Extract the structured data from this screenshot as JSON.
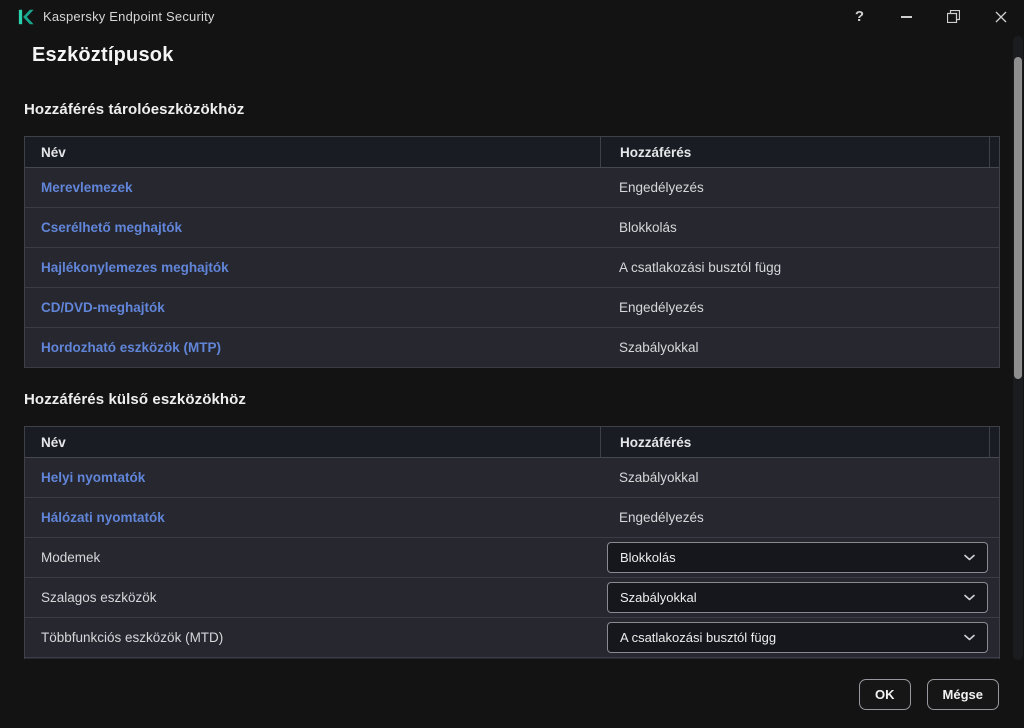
{
  "window": {
    "title": "Kaspersky Endpoint Security",
    "controls": {
      "help": "?"
    }
  },
  "page": {
    "title": "Eszköztípusok"
  },
  "sections": [
    {
      "heading": "Hozzáférés tárolóeszközökhöz",
      "columns": [
        "Név",
        "Hozzáférés"
      ],
      "rows": [
        {
          "name": "Merevlemezek",
          "access": "Engedélyezés",
          "control": "link"
        },
        {
          "name": "Cserélhető meghajtók",
          "access": "Blokkolás",
          "control": "link"
        },
        {
          "name": "Hajlékonylemezes meghajtók",
          "access": "A csatlakozási busztól függ",
          "control": "link"
        },
        {
          "name": "CD/DVD-meghajtók",
          "access": "Engedélyezés",
          "control": "link"
        },
        {
          "name": "Hordozható eszközök (MTP)",
          "access": "Szabályokkal",
          "control": "link"
        }
      ]
    },
    {
      "heading": "Hozzáférés külső eszközökhöz",
      "columns": [
        "Név",
        "Hozzáférés"
      ],
      "rows": [
        {
          "name": "Helyi nyomtatók",
          "access": "Szabályokkal",
          "control": "link"
        },
        {
          "name": "Hálózati nyomtatók",
          "access": "Engedélyezés",
          "control": "link"
        },
        {
          "name": "Modemek",
          "access": "Blokkolás",
          "control": "select"
        },
        {
          "name": "Szalagos eszközök",
          "access": "Szabályokkal",
          "control": "select"
        },
        {
          "name": "Többfunkciós eszközök (MTD)",
          "access": "A csatlakozási busztól függ",
          "control": "select"
        }
      ]
    }
  ],
  "footer": {
    "ok": "OK",
    "cancel": "Mégse"
  },
  "colors": {
    "background": "#131313",
    "row_bg": "#26272f",
    "header_bg": "#1a1c24",
    "link_blue": "#6185d8",
    "accent_teal": "#2ad1ae",
    "scroll_thumb": "#8e8e8e"
  }
}
